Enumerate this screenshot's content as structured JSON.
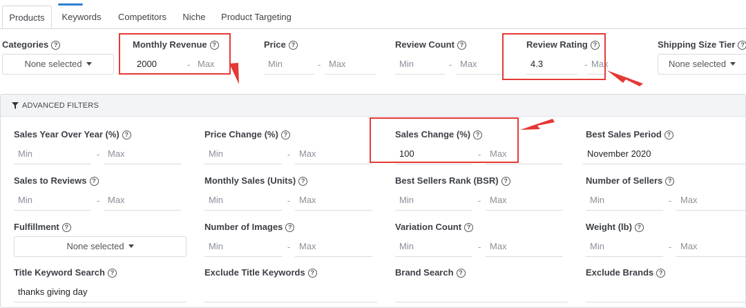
{
  "tabs": [
    {
      "label": "Products"
    },
    {
      "label": "Keywords"
    },
    {
      "label": "Competitors"
    },
    {
      "label": "Niche"
    },
    {
      "label": "Product Targeting"
    }
  ],
  "help_glyph": "?",
  "range": {
    "min_placeholder": "Min",
    "max_placeholder": "Max",
    "separator": "-"
  },
  "filters": {
    "categories": {
      "label": "Categories",
      "value": "None selected"
    },
    "monthly_revenue": {
      "label": "Monthly Revenue",
      "min": "2000"
    },
    "price": {
      "label": "Price"
    },
    "review_count": {
      "label": "Review Count"
    },
    "review_rating": {
      "label": "Review Rating",
      "min": "4.3"
    },
    "shipping_size_tier": {
      "label": "Shipping Size Tier",
      "value": "None selected"
    }
  },
  "advanced": {
    "title": "ADVANCED FILTERS",
    "sales_yoy": {
      "label": "Sales Year Over Year (%)"
    },
    "price_change": {
      "label": "Price Change (%)"
    },
    "sales_change": {
      "label": "Sales Change (%)",
      "min": "100"
    },
    "best_sales_period": {
      "label": "Best Sales Period",
      "value": "November 2020"
    },
    "sales_to_reviews": {
      "label": "Sales to Reviews"
    },
    "monthly_sales_units": {
      "label": "Monthly Sales (Units)"
    },
    "bsr": {
      "label": "Best Sellers Rank (BSR)"
    },
    "number_of_sellers": {
      "label": "Number of Sellers"
    },
    "fulfillment": {
      "label": "Fulfillment",
      "value": "None selected"
    },
    "number_of_images": {
      "label": "Number of Images"
    },
    "variation_count": {
      "label": "Variation Count"
    },
    "weight_lb": {
      "label": "Weight (lb)"
    },
    "title_keyword_search": {
      "label": "Title Keyword Search",
      "value": "thanks giving day"
    },
    "exclude_title_keywords": {
      "label": "Exclude Title Keywords"
    },
    "brand_search": {
      "label": "Brand Search"
    },
    "exclude_brands": {
      "label": "Exclude Brands"
    }
  },
  "annotation_color": "#e53935"
}
